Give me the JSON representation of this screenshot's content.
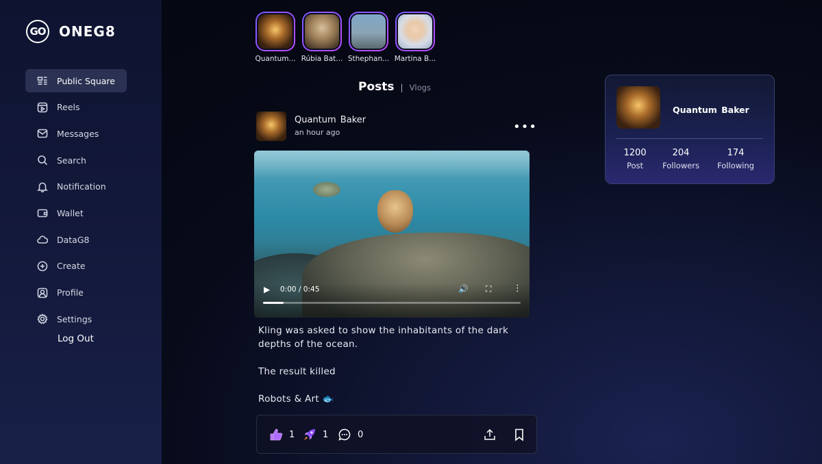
{
  "brand": {
    "logo_mark": "GO",
    "name": "ONEG8"
  },
  "nav": {
    "items": [
      {
        "label": "Public Square",
        "icon": "public-square-icon",
        "active": true
      },
      {
        "label": "Reels",
        "icon": "reels-icon"
      },
      {
        "label": "Messages",
        "icon": "messages-icon"
      },
      {
        "label": "Search",
        "icon": "search-icon"
      },
      {
        "label": "Notification",
        "icon": "bell-icon"
      },
      {
        "label": "Wallet",
        "icon": "wallet-icon"
      },
      {
        "label": "DataG8",
        "icon": "cloud-icon"
      },
      {
        "label": "Create",
        "icon": "plus-icon"
      },
      {
        "label": "Profile",
        "icon": "profile-icon"
      },
      {
        "label": "Settings",
        "icon": "gear-icon"
      }
    ],
    "logout": "Log Out"
  },
  "stories": [
    {
      "name": "Quantum..."
    },
    {
      "name": "Rúbia Bat..."
    },
    {
      "name": "Sthephan..."
    },
    {
      "name": "Martina B..."
    }
  ],
  "tabs": {
    "posts": "Posts",
    "separator": "|",
    "vlogs": "Vlogs"
  },
  "post": {
    "author": "Quantum  Baker",
    "time": "an hour ago",
    "more": "•••",
    "video": {
      "time": "0:00 / 0:45",
      "progress": 0.08
    },
    "text": [
      "Kling was asked to show the inhabitants of the dark depths of the ocean.",
      "The result killed",
      "Robots & Art 🐟"
    ],
    "likes": "1",
    "boosts": "1",
    "comments": "0"
  },
  "profile_card": {
    "name": "Quantum  Baker",
    "stats": [
      {
        "value": "1200",
        "label": "Post"
      },
      {
        "value": "204",
        "label": "Followers"
      },
      {
        "value": "174",
        "label": "Following"
      }
    ]
  },
  "colors": {
    "accent": "#7a5cff",
    "like": "#b06bff",
    "boost": "#8a4dff"
  }
}
